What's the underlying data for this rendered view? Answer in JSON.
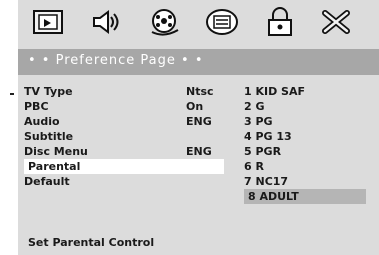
{
  "icons": [
    "tv-setup-icon",
    "audio-speaker-icon",
    "video-reel-icon",
    "preference-box-icon",
    "password-lock-icon",
    "exit-x-icon"
  ],
  "header": {
    "title": "• • Preference Page • •"
  },
  "menu": {
    "items": [
      {
        "label": "TV Type",
        "value": "Ntsc"
      },
      {
        "label": "PBC",
        "value": "On"
      },
      {
        "label": "Audio",
        "value": "ENG"
      },
      {
        "label": "Subtitle",
        "value": ""
      },
      {
        "label": "Disc Menu",
        "value": "ENG"
      },
      {
        "label": "Parental",
        "value": ""
      },
      {
        "label": "Default",
        "value": ""
      }
    ]
  },
  "parental_options": [
    "1 KID SAF",
    "2 G",
    "3 PG",
    "4 PG 13",
    "5 PGR",
    "6 R",
    "7 NC17",
    "8 ADULT"
  ],
  "footer": {
    "help": "Set Parental Control"
  },
  "colors": {
    "panel": "#dcdcdc",
    "header_bar": "#a7a7a7",
    "selected_row": "#ffffff",
    "highlight_option": "#b5b5b5"
  }
}
